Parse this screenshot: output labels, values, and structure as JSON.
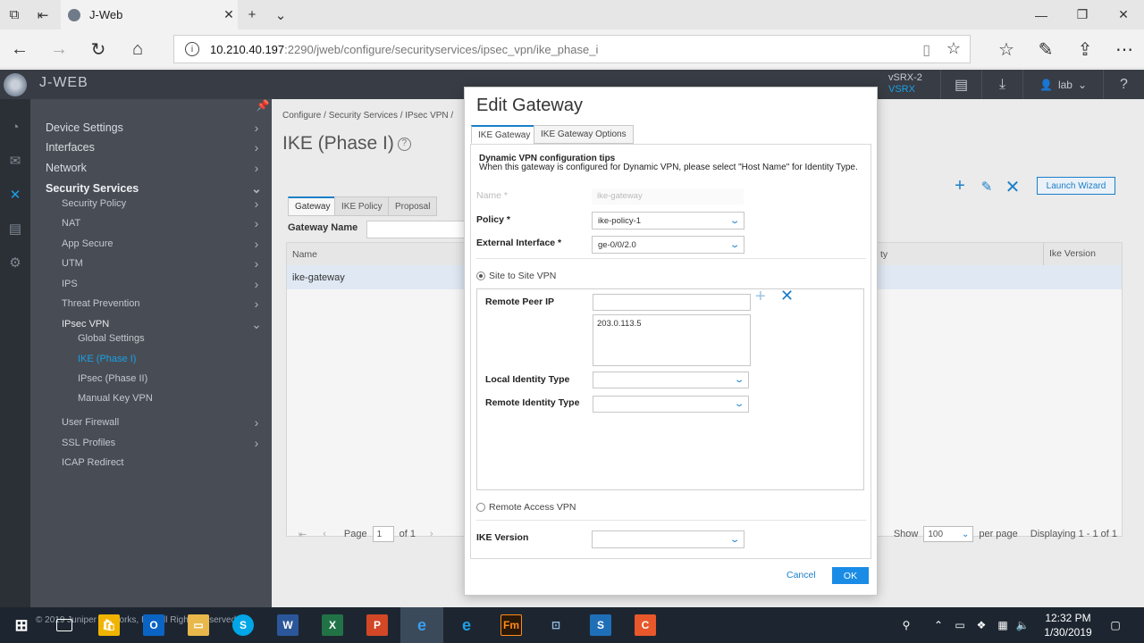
{
  "browser": {
    "tab_title": "J-Web",
    "url_host": "10.210.40.197",
    "url_path": ":2290/jweb/configure/securityservices/ipsec_vpn/ike_phase_i"
  },
  "app": {
    "brand": "J-WEB",
    "device_name": "vSRX-2",
    "device_model": "VSRX",
    "user": "lab",
    "help": "?"
  },
  "sidebar": {
    "items": [
      {
        "label": "Device Settings"
      },
      {
        "label": "Interfaces"
      },
      {
        "label": "Network"
      },
      {
        "label": "Security Services"
      },
      {
        "label": "Security Policy"
      },
      {
        "label": "NAT"
      },
      {
        "label": "App Secure"
      },
      {
        "label": "UTM"
      },
      {
        "label": "IPS"
      },
      {
        "label": "Threat Prevention"
      },
      {
        "label": "IPsec VPN"
      },
      {
        "label": "Global Settings"
      },
      {
        "label": "IKE (Phase I)"
      },
      {
        "label": "IPsec (Phase II)"
      },
      {
        "label": "Manual Key VPN"
      },
      {
        "label": "User Firewall"
      },
      {
        "label": "SSL Profiles"
      },
      {
        "label": "ICAP Redirect"
      }
    ]
  },
  "main": {
    "breadcrumb": "Configure  /  Security Services  /  IPsec VPN  /",
    "title": "IKE (Phase I)",
    "launch_wizard": "Launch Wizard",
    "tabs": [
      "Gateway",
      "IKE Policy",
      "Proposal"
    ],
    "filter_label": "Gateway Name",
    "columns": [
      "Name",
      "ty",
      "Ike Version"
    ],
    "rows": [
      {
        "name": "ike-gateway"
      }
    ],
    "pager": {
      "page_label": "Page",
      "page_value": "1",
      "of_label": "of 1",
      "show_label": "Show",
      "show_value": "100",
      "per_page": "per page",
      "displaying": "Displaying 1 - 1 of 1"
    }
  },
  "modal": {
    "title": "Edit Gateway",
    "tabs": [
      "IKE Gateway",
      "IKE Gateway Options"
    ],
    "tips_title": "Dynamic VPN configuration tips",
    "tips_body": "When this gateway is configured for Dynamic VPN, please select \"Host Name\" for Identity Type.",
    "name_label": "Name *",
    "name_value": "ike-gateway",
    "policy_label": "Policy *",
    "policy_value": "ike-policy-1",
    "ext_if_label": "External Interface *",
    "ext_if_value": "ge-0/0/2.0",
    "site_to_site": "Site to Site VPN",
    "remote_peer_label": "Remote Peer IP",
    "remote_peer_input": "",
    "remote_peer_list": [
      "203.0.113.5"
    ],
    "local_id_label": "Local Identity Type",
    "local_id_value": "",
    "remote_id_label": "Remote Identity Type",
    "remote_id_value": "",
    "remote_access": "Remote Access VPN",
    "ike_version_label": "IKE Version",
    "ike_version_value": "",
    "cancel": "Cancel",
    "ok": "OK"
  },
  "taskbar": {
    "time": "12:32 PM",
    "date": "1/30/2019",
    "partial_text": "© 2019 Juniper Networks, Inc. All Rights Reserved"
  },
  "colors": {
    "accent": "#1a7fc8",
    "ok_button": "#1a8ce6",
    "sidebar_bg": "#484d55",
    "header_bg": "#383c44"
  }
}
